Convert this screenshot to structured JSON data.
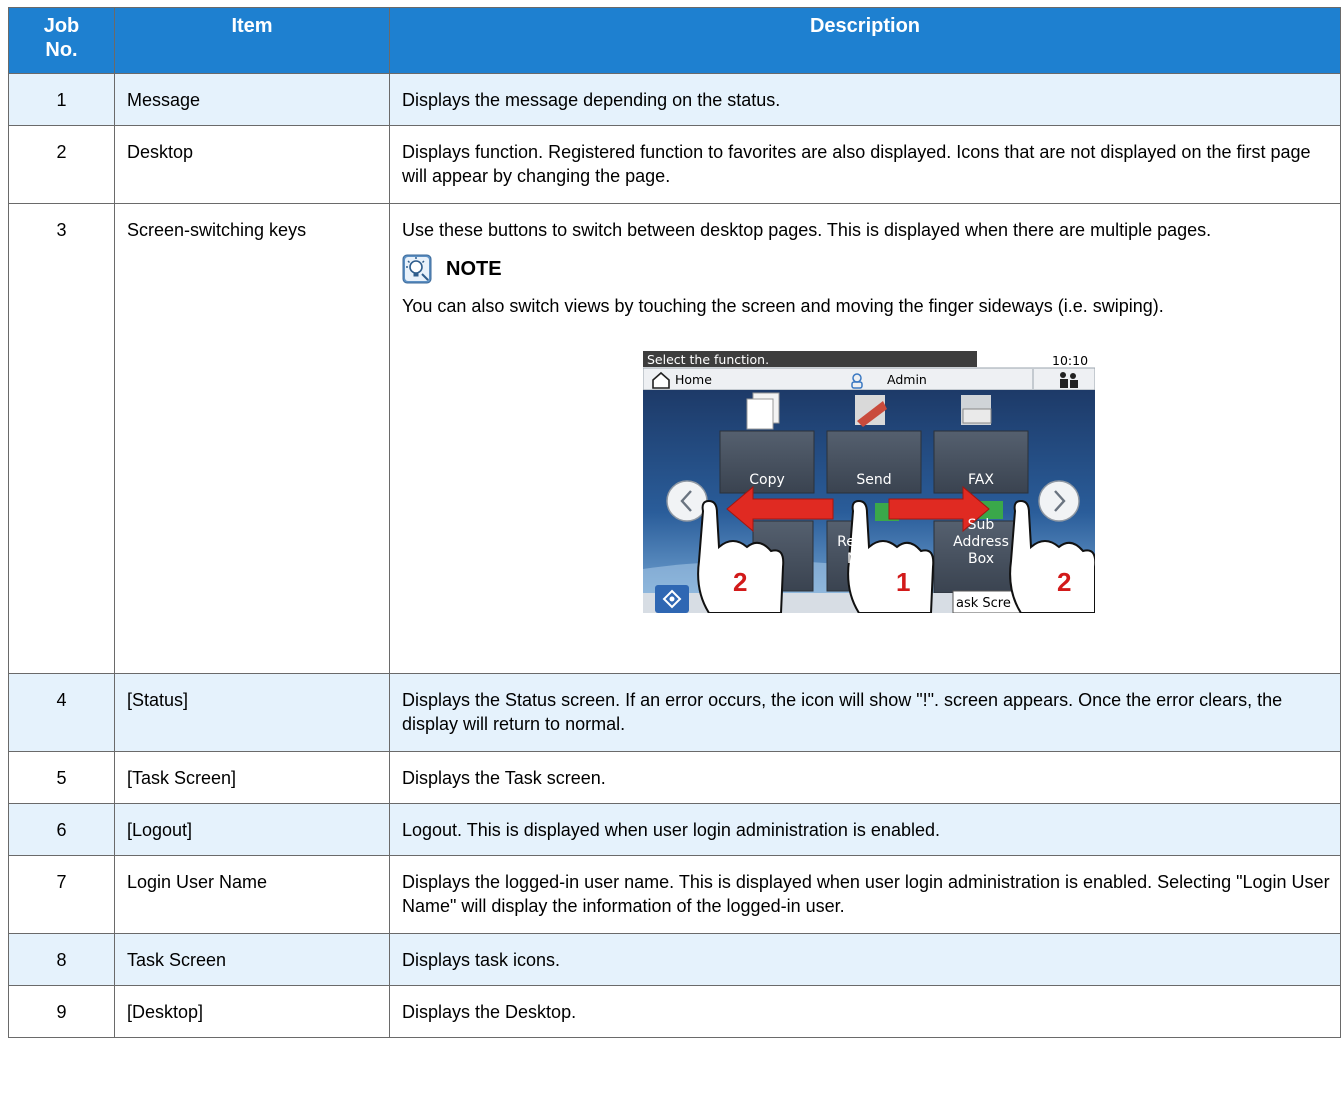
{
  "table": {
    "headers": {
      "job_no": "Job\nNo.",
      "item": "Item",
      "description": "Description"
    },
    "rows": [
      {
        "no": "1",
        "item": "Message",
        "desc": "Displays the message depending on the status."
      },
      {
        "no": "2",
        "item": "Desktop",
        "desc": "Displays function. Registered function to favorites are also displayed. Icons that are not displayed on the first page will appear by changing the page."
      },
      {
        "no": "3",
        "item": "Screen-switching keys",
        "desc": "Use these buttons to switch between desktop pages. This is displayed when there are multiple pages."
      },
      {
        "no": "4",
        "item": "[Status]",
        "desc": "Displays the Status screen. If an error occurs, the icon will show \"!\". screen appears. Once the error clears, the display will return to normal."
      },
      {
        "no": "5",
        "item": "[Task Screen]",
        "desc": "Displays the Task screen."
      },
      {
        "no": "6",
        "item": "[Logout]",
        "desc": "Logout. This is displayed when user login administration is enabled."
      },
      {
        "no": "7",
        "item": "Login User Name",
        "desc": "Displays the logged-in user name. This is displayed when user login administration is enabled. Selecting \"Login User Name\" will display the information of the logged-in user."
      },
      {
        "no": "8",
        "item": "Task Screen",
        "desc": "Displays task icons."
      },
      {
        "no": "9",
        "item": "[Desktop]",
        "desc": "Displays the Desktop."
      }
    ]
  },
  "note": {
    "title": "NOTE",
    "body": "You can also switch views by touching the screen and moving the finger sideways (i.e. swiping).",
    "icon": "lightbulb-icon"
  },
  "panel": {
    "message": "Select the function.",
    "time": "10:10",
    "home_label": "Home",
    "user_label": "Admin",
    "buttons": {
      "copy": "Copy",
      "send": "Send",
      "fax": "FAX",
      "re": "Re",
      "m": "M",
      "sub_address_box": "Sub\nAddress\nBox",
      "task_screen": "ask Scre"
    },
    "swipe_numbers": {
      "left": "2",
      "center": "1",
      "right": "2"
    },
    "colors": {
      "header_blue": "#1e80d0",
      "row_shade": "#e5f2fc",
      "arrow_red": "#e02a22",
      "number_red": "#d21a1a"
    }
  }
}
